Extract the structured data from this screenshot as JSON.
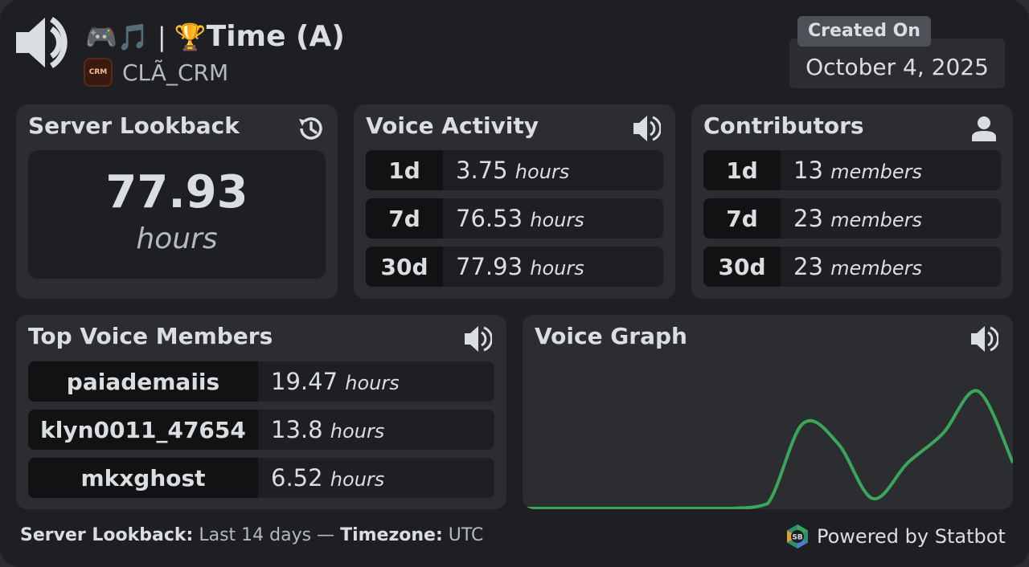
{
  "header": {
    "title_emojis": "🎮🎵 | 🏆",
    "title": "Time (A)",
    "server_name": "CLÃ_CRM",
    "server_icon_text": "CRM",
    "created_label": "Created On",
    "created_date": "October 4, 2025"
  },
  "server_lookback": {
    "title": "Server Lookback",
    "value": "77.93",
    "unit": "hours"
  },
  "voice_activity": {
    "title": "Voice Activity",
    "rows": [
      {
        "period": "1d",
        "value": "3.75",
        "unit": "hours"
      },
      {
        "period": "7d",
        "value": "76.53",
        "unit": "hours"
      },
      {
        "period": "30d",
        "value": "77.93",
        "unit": "hours"
      }
    ]
  },
  "contributors": {
    "title": "Contributors",
    "rows": [
      {
        "period": "1d",
        "value": "13",
        "unit": "members"
      },
      {
        "period": "7d",
        "value": "23",
        "unit": "members"
      },
      {
        "period": "30d",
        "value": "23",
        "unit": "members"
      }
    ]
  },
  "top_members": {
    "title": "Top Voice Members",
    "rows": [
      {
        "name": "paiademaiis",
        "value": "19.47",
        "unit": "hours"
      },
      {
        "name": "klyn0011_47654",
        "value": "13.8",
        "unit": "hours"
      },
      {
        "name": "mkxghost",
        "value": "6.52",
        "unit": "hours"
      }
    ]
  },
  "voice_graph": {
    "title": "Voice Graph",
    "line_color": "#3ba55c"
  },
  "chart_data": {
    "type": "area",
    "x": [
      0,
      1,
      2,
      3,
      4,
      5,
      6,
      7,
      8,
      9,
      10,
      11,
      12,
      13,
      14
    ],
    "values": [
      0,
      0,
      0,
      0,
      0,
      0,
      0,
      0.3,
      5.2,
      4.0,
      0.6,
      2.8,
      4.6,
      7.2,
      2.8
    ],
    "grid": false,
    "legend": "none"
  },
  "footer": {
    "lookback_label": "Server Lookback:",
    "lookback_value": "Last 14 days —",
    "timezone_label": "Timezone:",
    "timezone_value": "UTC",
    "powered_by": "Powered by Statbot",
    "logo_text": "SB"
  },
  "colors": {
    "accent_green": "#3ba55c",
    "card_bg": "#1e1f22",
    "panel_bg": "#2b2d31"
  }
}
